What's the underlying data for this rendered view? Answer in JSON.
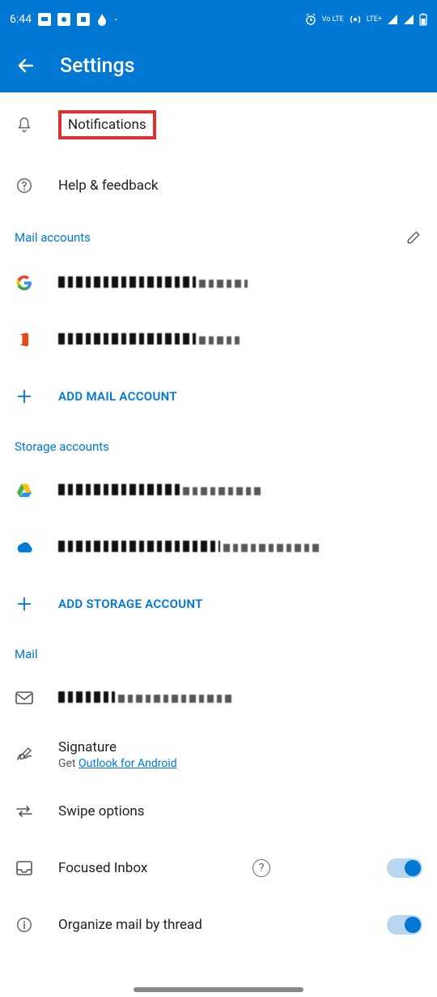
{
  "status": {
    "time": "6:44",
    "lte_label": "LTE+",
    "vo_label": "Vo LTE"
  },
  "header": {
    "title": "Settings"
  },
  "items": {
    "notifications": "Notifications",
    "help": "Help & feedback"
  },
  "sections": {
    "mail_accounts": "Mail accounts",
    "storage_accounts": "Storage accounts",
    "mail": "Mail"
  },
  "actions": {
    "add_mail": "ADD MAIL ACCOUNT",
    "add_storage": "ADD STORAGE ACCOUNT"
  },
  "mail_settings": {
    "signature_label": "Signature",
    "signature_sub_prefix": "Get ",
    "signature_link": "Outlook for Android",
    "swipe": "Swipe options",
    "focused": "Focused Inbox",
    "thread": "Organize mail by thread"
  },
  "toggles": {
    "focused": true,
    "thread": true
  }
}
